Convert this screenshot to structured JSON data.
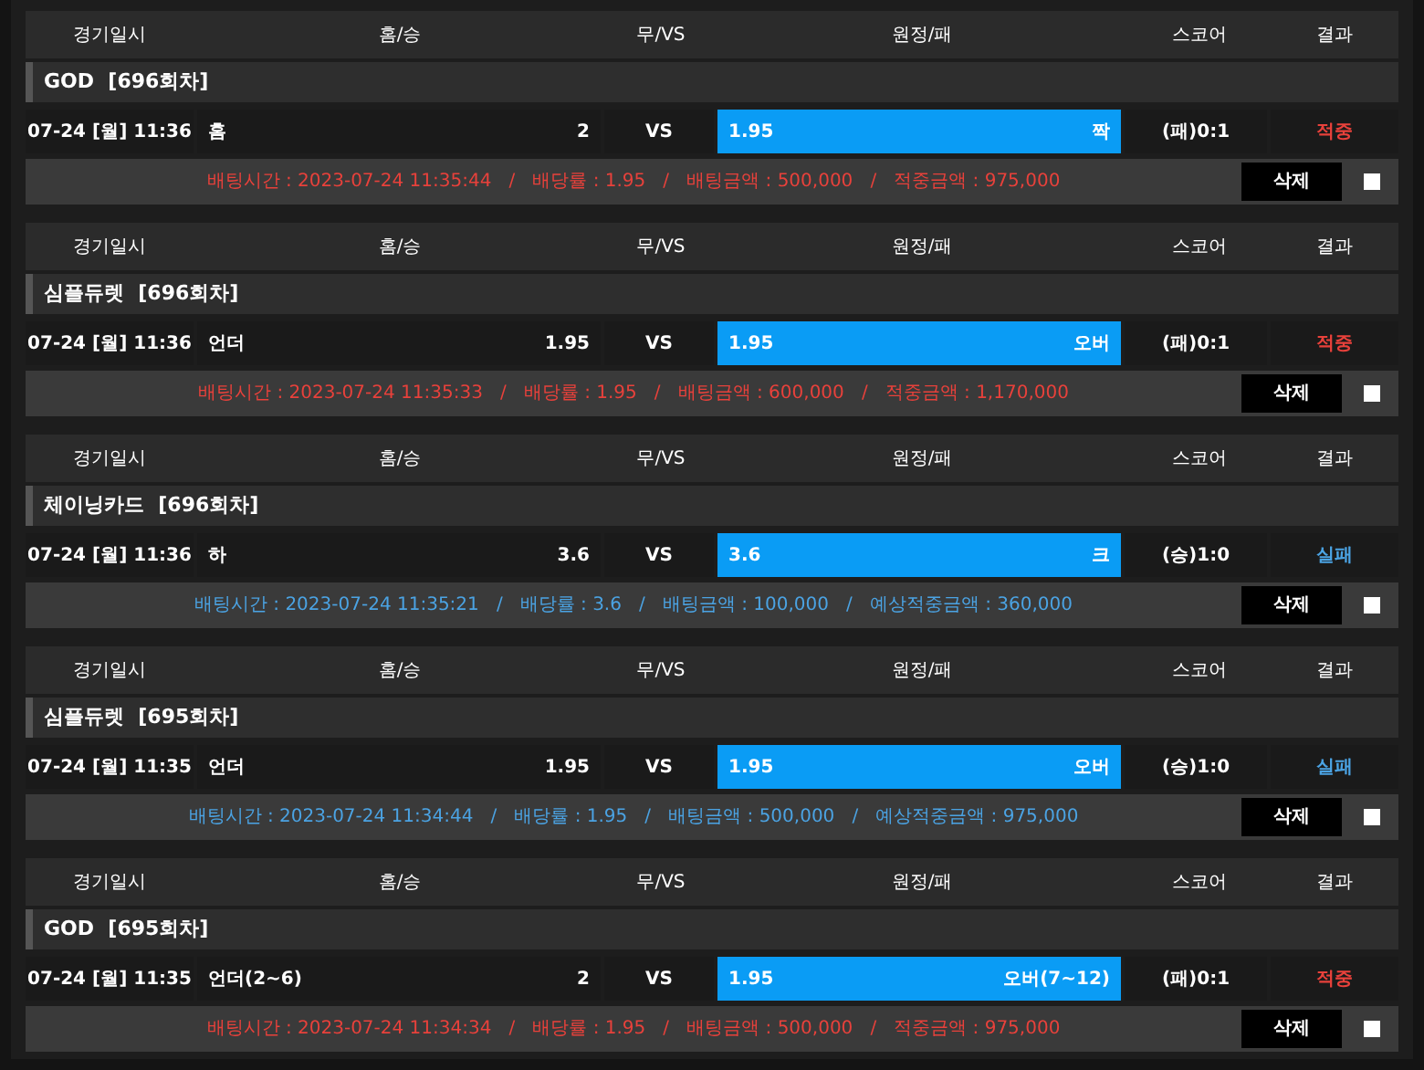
{
  "bets": [
    {
      "columns": [
        "경기일시",
        "홈/승",
        "무/VS",
        "원정/패",
        "스코어",
        "결과"
      ],
      "game": "GOD  [696회차]",
      "date": "07-24 [월] 11:36",
      "home": "홈",
      "home_odds": "2",
      "vs": "VS",
      "away_odds": "1.95",
      "away": "짝",
      "away_selected": true,
      "score": "(패)0:1",
      "result": "적중",
      "kind": "hit",
      "info": "배팅시간 : 2023-07-24 11:35:44   /   배당률 : 1.95   /   배팅금액 : 500,000   /   적중금액 : 975,000",
      "delete": "삭제",
      "checked": false
    },
    {
      "columns": [
        "경기일시",
        "홈/승",
        "무/VS",
        "원정/패",
        "스코어",
        "결과"
      ],
      "game": "심플듀렛  [696회차]",
      "date": "07-24 [월] 11:36",
      "home": "언더",
      "home_odds": "1.95",
      "vs": "VS",
      "away_odds": "1.95",
      "away": "오버",
      "away_selected": true,
      "score": "(패)0:1",
      "result": "적중",
      "kind": "hit",
      "info": "배팅시간 : 2023-07-24 11:35:33   /   배당률 : 1.95   /   배팅금액 : 600,000   /   적중금액 : 1,170,000",
      "delete": "삭제",
      "checked": false
    },
    {
      "columns": [
        "경기일시",
        "홈/승",
        "무/VS",
        "원정/패",
        "스코어",
        "결과"
      ],
      "game": "체이닝카드  [696회차]",
      "date": "07-24 [월] 11:36",
      "home": "하",
      "home_odds": "3.6",
      "vs": "VS",
      "away_odds": "3.6",
      "away": "크",
      "away_selected": true,
      "score": "(승)1:0",
      "result": "실패",
      "kind": "miss",
      "info": "배팅시간 : 2023-07-24 11:35:21   /   배당률 : 3.6   /   배팅금액 : 100,000   /   예상적중금액 : 360,000",
      "delete": "삭제",
      "checked": false
    },
    {
      "columns": [
        "경기일시",
        "홈/승",
        "무/VS",
        "원정/패",
        "스코어",
        "결과"
      ],
      "game": "심플듀렛  [695회차]",
      "date": "07-24 [월] 11:35",
      "home": "언더",
      "home_odds": "1.95",
      "vs": "VS",
      "away_odds": "1.95",
      "away": "오버",
      "away_selected": true,
      "score": "(승)1:0",
      "result": "실패",
      "kind": "miss",
      "info": "배팅시간 : 2023-07-24 11:34:44   /   배당률 : 1.95   /   배팅금액 : 500,000   /   예상적중금액 : 975,000",
      "delete": "삭제",
      "checked": false
    },
    {
      "columns": [
        "경기일시",
        "홈/승",
        "무/VS",
        "원정/패",
        "스코어",
        "결과"
      ],
      "game": "GOD  [695회차]",
      "date": "07-24 [월] 11:35",
      "home": "언더(2~6)",
      "home_odds": "2",
      "vs": "VS",
      "away_odds": "1.95",
      "away": "오버(7~12)",
      "away_selected": true,
      "score": "(패)0:1",
      "result": "적중",
      "kind": "hit",
      "info": "배팅시간 : 2023-07-24 11:34:34   /   배당률 : 1.95   /   배팅금액 : 500,000   /   적중금액 : 975,000",
      "delete": "삭제",
      "checked": false
    }
  ]
}
